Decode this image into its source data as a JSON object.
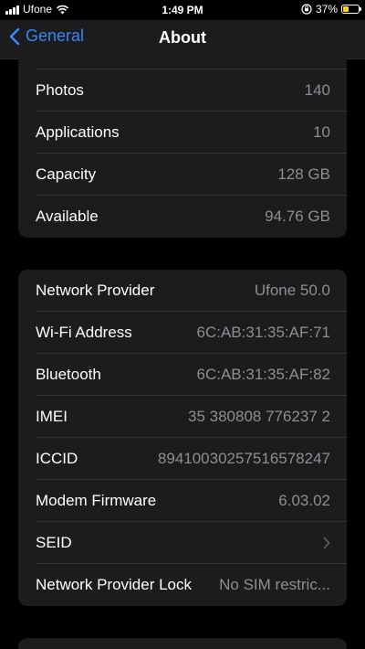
{
  "status_bar": {
    "carrier": "Ufone",
    "time": "1:49 PM",
    "battery_percent": "37%"
  },
  "nav": {
    "back_label": "General",
    "title": "About"
  },
  "storage_group": [
    {
      "label": "Photos",
      "value": "140"
    },
    {
      "label": "Applications",
      "value": "10"
    },
    {
      "label": "Capacity",
      "value": "128 GB"
    },
    {
      "label": "Available",
      "value": "94.76 GB"
    }
  ],
  "network_group": [
    {
      "label": "Network Provider",
      "value": "Ufone 50.0"
    },
    {
      "label": "Wi-Fi Address",
      "value": "6C:AB:31:35:AF:71"
    },
    {
      "label": "Bluetooth",
      "value": "6C:AB:31:35:AF:82"
    },
    {
      "label": "IMEI",
      "value": "35 380808 776237 2"
    },
    {
      "label": "ICCID",
      "value": "89410030257516578247"
    },
    {
      "label": "Modem Firmware",
      "value": "6.03.02"
    },
    {
      "label": "SEID",
      "value": ""
    },
    {
      "label": "Network Provider Lock",
      "value": "No SIM restric..."
    }
  ],
  "icons": {
    "back": "chevron-left-icon",
    "disclosure": "chevron-right-icon",
    "wifi": "wifi-icon",
    "orientation_lock": "orientation-lock-icon",
    "battery": "battery-charging-icon"
  },
  "colors": {
    "accent": "#3a86f7",
    "cell_background": "#1c1c1e",
    "secondary_text": "#8e8e93",
    "battery": "#ffd60a"
  }
}
